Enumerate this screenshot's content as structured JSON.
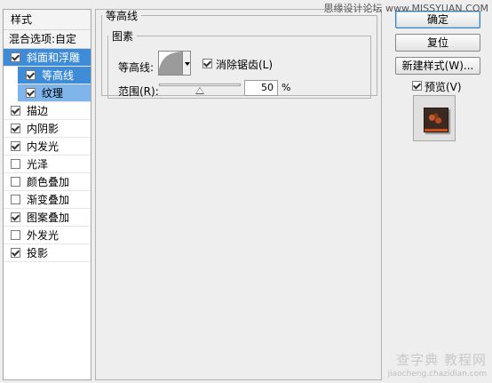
{
  "styles_panel": {
    "header": "样式",
    "blend_options": "混合选项:自定",
    "items": [
      {
        "label": "斜面和浮雕",
        "checked": true
      },
      {
        "label": "等高线",
        "checked": true
      },
      {
        "label": "纹理",
        "checked": true
      },
      {
        "label": "描边",
        "checked": true
      },
      {
        "label": "内阴影",
        "checked": true
      },
      {
        "label": "内发光",
        "checked": true
      },
      {
        "label": "光泽",
        "checked": false
      },
      {
        "label": "颜色叠加",
        "checked": false
      },
      {
        "label": "渐变叠加",
        "checked": false
      },
      {
        "label": "图案叠加",
        "checked": true
      },
      {
        "label": "外发光",
        "checked": false
      },
      {
        "label": "投影",
        "checked": true
      }
    ]
  },
  "contour_section": {
    "title": "等高线",
    "elements_group": "图素",
    "contour_label": "等高线:",
    "antialias_label": "消除锯齿(L)",
    "antialias_checked": true,
    "range_label": "范围(R):",
    "range_value": "50",
    "range_unit": "%",
    "range_fraction": 0.5
  },
  "buttons": {
    "ok": "确定",
    "reset": "复位",
    "new_style": "新建样式(W)...",
    "preview_label": "预览(V)",
    "preview_checked": true
  },
  "watermarks": {
    "top": "思缘设计论坛 www.MISSYUAN.COM",
    "bottom_main": "查字典 教程网",
    "bottom_small": "jiaocheng.chazidian.com"
  },
  "colors": {
    "selection": "#3e8bd8",
    "selection_light": "#7fb5ea"
  }
}
